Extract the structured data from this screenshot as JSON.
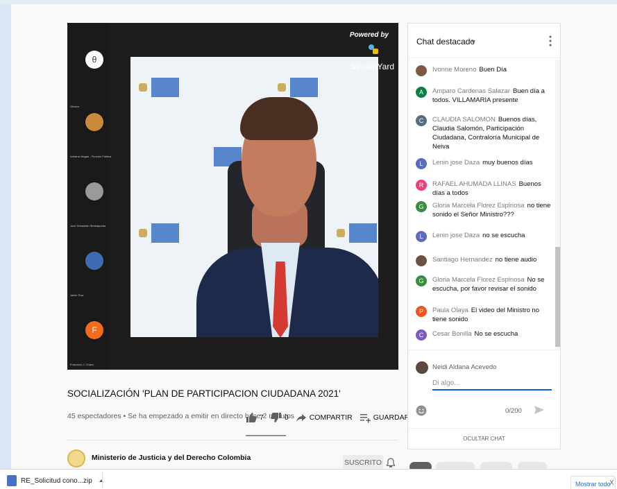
{
  "video": {
    "overlay": {
      "powered_by": "Powered by",
      "brand": "StreamYard"
    },
    "participants": [
      {
        "name": "Olivera",
        "initial": "θ",
        "color": "#ffffff"
      },
      {
        "name": "Adriana Vargas - Función Pública",
        "initial": "",
        "color": "#c98a3a"
      },
      {
        "name": "Juan Sebastián Simbaqueba",
        "initial": "",
        "color": "#9a9a9a"
      },
      {
        "name": "Javier Roa",
        "initial": "",
        "color": "#3d6db0"
      },
      {
        "name": "Francisco J. Chaux",
        "initial": "F",
        "color": "#f26a1b"
      }
    ]
  },
  "video_info": {
    "title": "SOCIALIZACIÓN 'PLAN DE PARTICIPACION CIUDADANA 2021'",
    "meta": "45 espectadores • Se ha empezado a emitir en directo hace 2 minutos",
    "likes": "7",
    "dislikes": "0",
    "share_label": "COMPARTIR",
    "save_label": "GUARDAR",
    "more_label": "..."
  },
  "channel": {
    "name": "Ministerio de Justicia y del Derecho Colombia",
    "subscribe_label": "SUSCRITO"
  },
  "chat": {
    "title": "Chat destacado",
    "messages": [
      {
        "author": "Ivonne Moreno",
        "text": "Buen Día",
        "initial": "",
        "color": "#7d5a44"
      },
      {
        "author": "Amparo Cardenas Salazar",
        "text": "Buen día a todos. VILLAMARIA presente",
        "initial": "A",
        "color": "#0b8043"
      },
      {
        "author": "CLAUDIA SALOMON",
        "text": "Buenos días, Claudia Salomón, Participación Ciudadana, Contraloría Municipal de Neiva",
        "initial": "C",
        "color": "#546e7a"
      },
      {
        "author": "Lenin jose Daza",
        "text": "muy buenos días",
        "initial": "L",
        "color": "#5c6bc0"
      },
      {
        "author": "RAFAEL AHUMADA LLINAS",
        "text": "Buenos días a todos",
        "initial": "R",
        "color": "#ec407a"
      },
      {
        "author": "Gloria Marcela Florez Espinosa",
        "text": "no tiene sonido el Señor Ministro???",
        "initial": "G",
        "color": "#388e3c"
      },
      {
        "author": "Lenin jose Daza",
        "text": "no se escucha",
        "initial": "L",
        "color": "#5c6bc0"
      },
      {
        "author": "Santiago Hernandez",
        "text": "no tiene audio",
        "initial": "",
        "color": "#6d5046"
      },
      {
        "author": "Gloria Marcela Florez Espinosa",
        "text": "No se escucha, por favor revisar el sonido",
        "initial": "G",
        "color": "#388e3c"
      },
      {
        "author": "Paula Olaya",
        "text": "El video del Ministro no tiene sonido",
        "initial": "P",
        "color": "#f4511e"
      },
      {
        "author": "Cesar Bonilla",
        "text": "No se escucha",
        "initial": "C",
        "color": "#7e57c2"
      }
    ],
    "current_user": "Neidi Aldana Acevedo",
    "input_placeholder": "Di algo...",
    "counter": "0/200",
    "hide_label": "OCULTAR CHAT"
  },
  "download_bar": {
    "file_name": "RE_Solicitud cono...zip",
    "show_all_label": "Mostrar todo",
    "close_label": "X"
  },
  "colors": {
    "accent": "#065fd4",
    "download_link": "#1a73e8"
  }
}
